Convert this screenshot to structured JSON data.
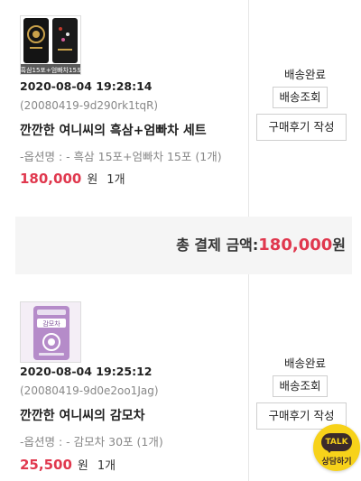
{
  "orders": [
    {
      "datetime": "2020-08-04 19:28:14",
      "order_id": "(20080419-9d290rk1tqR)",
      "product_name": "깐깐한 여니씨의 흑삼+엄빠차 세트",
      "option": "-옵션명 : - 흑삼 15포+엄빠차 15포 (1개)",
      "price": "180,000",
      "currency": "원",
      "quantity": "1개",
      "thumb_caption": "흑삼15포+엄빠차15포",
      "status": "배송완료",
      "track_label": "배송조회",
      "review_label": "구매후기 작성"
    },
    {
      "datetime": "2020-08-04 19:25:12",
      "order_id": "(20080419-9d0e2oo1Jag)",
      "product_name": "깐깐한 여니씨의 감모차",
      "option": "-옵션명 : - 감모차 30포 (1개)",
      "price": "25,500",
      "currency": "원",
      "quantity": "1개",
      "thumb_caption": "감모차",
      "status": "배송완료",
      "track_label": "배송조회",
      "review_label": "구매후기 작성"
    }
  ],
  "total": {
    "label": "총 결제 금액:",
    "amount": "180,000",
    "currency": "원"
  },
  "kakao": {
    "bubble_text": "TALK",
    "sub_text": "상담하기",
    "icon": "kakao-talk-icon"
  },
  "colors": {
    "price_red": "#e0384e",
    "kakao_yellow": "#f7d21a",
    "kakao_brown": "#3b2a2a"
  }
}
